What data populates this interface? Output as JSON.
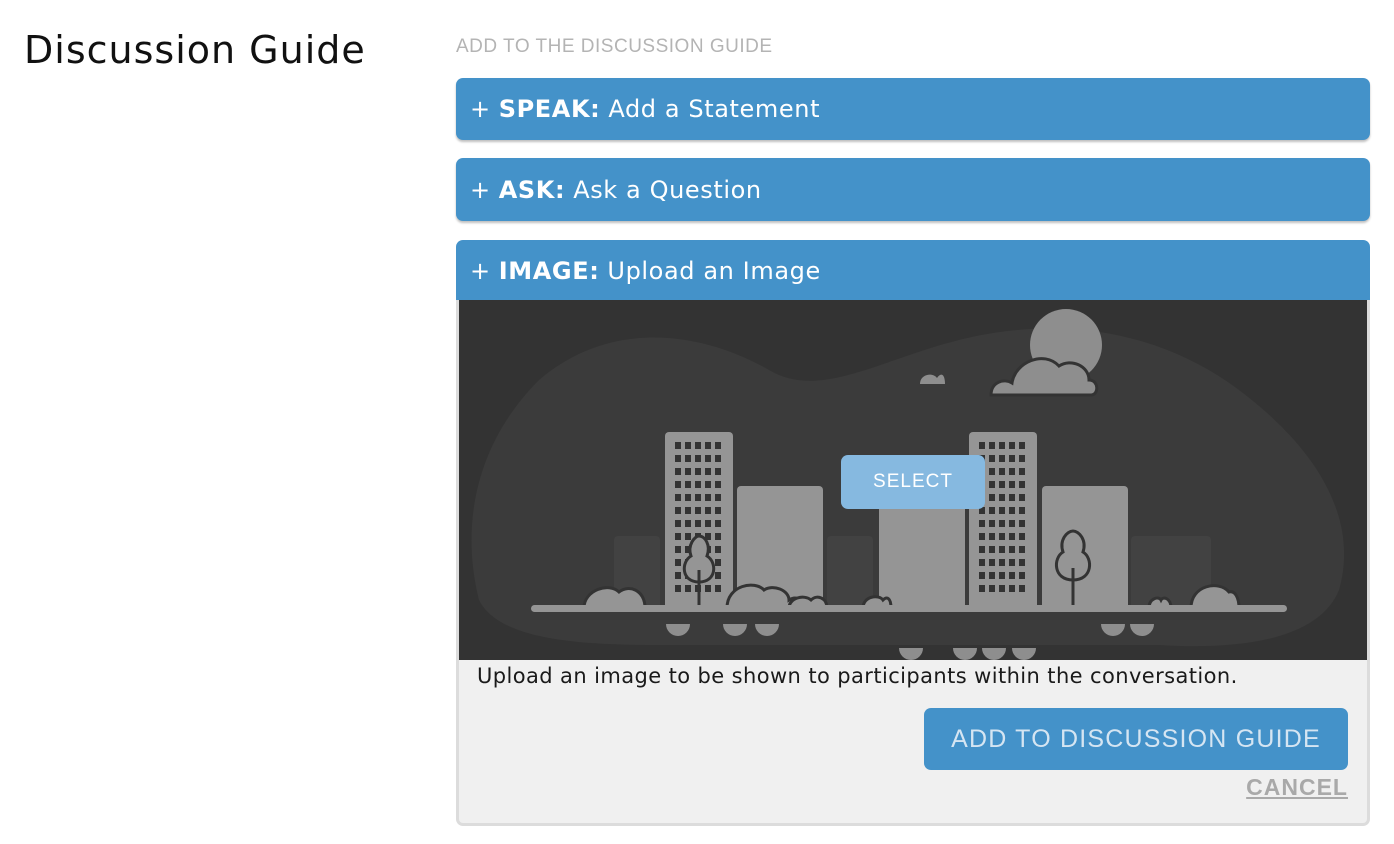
{
  "page": {
    "title": "Discussion Guide"
  },
  "section": {
    "label": "ADD TO THE DISCUSSION GUIDE"
  },
  "actions": [
    {
      "plus": "+",
      "keyword": "SPEAK:",
      "label": "Add a Statement"
    },
    {
      "plus": "+",
      "keyword": "ASK:",
      "label": "Ask a Question"
    },
    {
      "plus": "+",
      "keyword": "IMAGE:",
      "label": "Upload an Image"
    }
  ],
  "image_upload": {
    "placeholder_icon": "city-skyline-illustration",
    "select_label": "SELECT",
    "description": "Upload an image to be shown to participants within the conversation.",
    "submit_label": "ADD TO DISCUSSION GUIDE",
    "cancel_label": "CANCEL"
  },
  "colors": {
    "primary": "#4492c9",
    "select_button": "#86b9e0",
    "panel_background": "#f0f0f0",
    "image_placeholder_bg": "#333333"
  }
}
